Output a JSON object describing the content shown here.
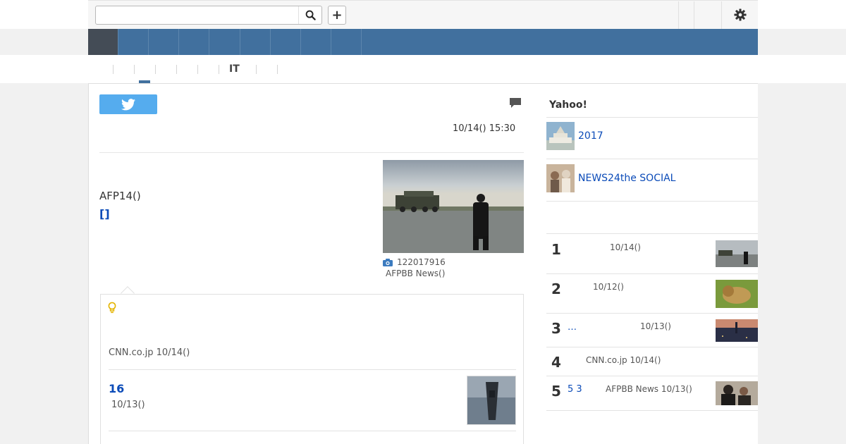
{
  "header": {
    "search_value": "",
    "search_placeholder": "",
    "add_label": "+"
  },
  "subnav": {
    "it_label": "IT"
  },
  "article": {
    "datetime": "10/14() 15:30",
    "lead_text": "AFP14()",
    "lead_link": "[]",
    "photo_count": "122017916",
    "photo_credit": "AFPBB News()"
  },
  "related": {
    "source": "CNN.co.jp 10/14()",
    "item_title": "16",
    "item_date": "10/13()"
  },
  "sidebar": {
    "title": "Yahoo!",
    "picks": [
      {
        "label": "2017"
      },
      {
        "label": "NEWS24the SOCIAL"
      }
    ],
    "ranking": [
      {
        "num": "1",
        "title": "",
        "meta": "10/14()"
      },
      {
        "num": "2",
        "title": "",
        "meta": "10/12()"
      },
      {
        "num": "3",
        "title": "…",
        "meta": "10/13()"
      },
      {
        "num": "4",
        "title": "",
        "meta": "CNN.co.jp   10/14()"
      },
      {
        "num": "5",
        "title": "5 3",
        "meta": "AFPBB News   10/13()"
      }
    ]
  }
}
